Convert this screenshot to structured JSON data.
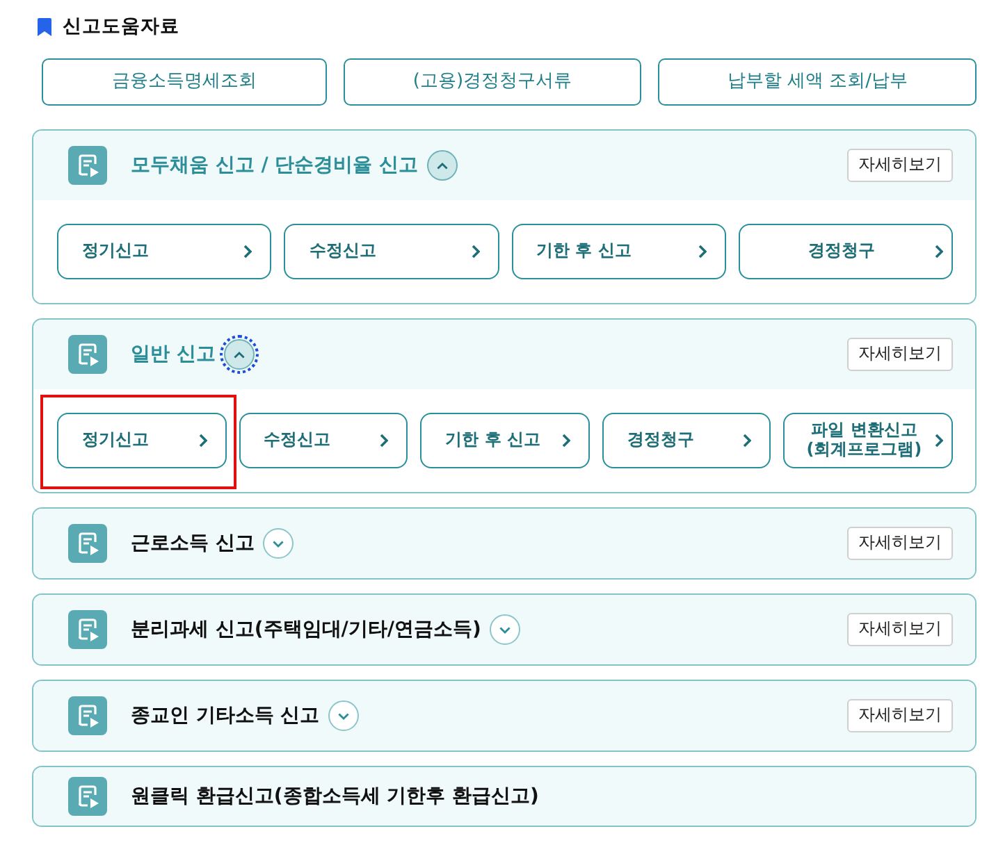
{
  "heading": {
    "title": "신고도움자료"
  },
  "quick_links": [
    {
      "label": "금융소득명세조회"
    },
    {
      "label": "(고용)경정청구서류"
    },
    {
      "label": "납부할 세액 조회/납부"
    }
  ],
  "sections": [
    {
      "title": "모두채움 신고 / 단순경비율 신고",
      "toggle": {
        "expanded": true,
        "focused": false
      },
      "details_button": "자세히보기",
      "actions": [
        {
          "label": "정기신고",
          "highlighted": false
        },
        {
          "label": "수정신고",
          "highlighted": false
        },
        {
          "label": "기한 후 신고",
          "highlighted": false
        },
        {
          "label": "경정청구",
          "highlighted": false
        }
      ]
    },
    {
      "title": "일반 신고",
      "toggle": {
        "expanded": true,
        "focused": true
      },
      "details_button": "자세히보기",
      "actions": [
        {
          "label": "정기신고",
          "highlighted": true
        },
        {
          "label": "수정신고",
          "highlighted": false
        },
        {
          "label": "기한 후 신고",
          "highlighted": false
        },
        {
          "label": "경정청구",
          "highlighted": false
        },
        {
          "label": "파일 변환신고\n(회계프로그램)",
          "highlighted": false
        }
      ]
    },
    {
      "title": "근로소득 신고",
      "toggle": {
        "expanded": false,
        "focused": false
      },
      "details_button": "자세히보기"
    },
    {
      "title": "분리과세 신고(주택임대/기타/연금소득)",
      "toggle": {
        "expanded": false,
        "focused": false
      },
      "details_button": "자세히보기"
    },
    {
      "title": "종교인 기타소득 신고",
      "toggle": {
        "expanded": false,
        "focused": false
      },
      "details_button": "자세히보기"
    },
    {
      "title": "원클릭 환급신고(종합소득세 기한후 환급신고)"
    }
  ]
}
